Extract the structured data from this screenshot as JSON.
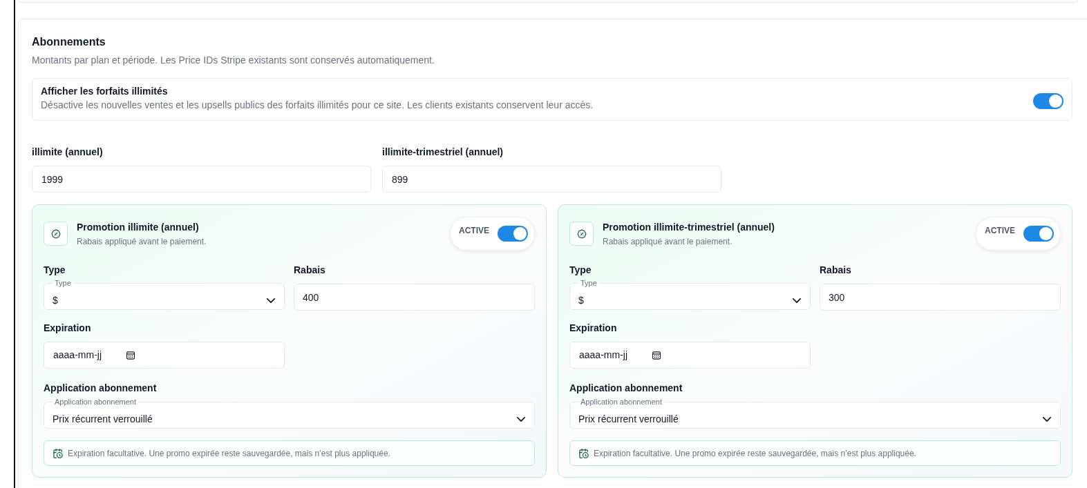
{
  "section": {
    "title": "Abonnements",
    "description": "Montants par plan et période. Les Price IDs Stripe existants sont conservés automatiquement."
  },
  "unlimited_setting": {
    "title": "Afficher les forfaits illimités",
    "description": "Désactive les nouvelles ventes et les upsells publics des forfaits illimités pour ce site. Les clients existants conservent leur accès.",
    "on": true
  },
  "price_fields": [
    {
      "label": "illimite (annuel)",
      "value": "1999"
    },
    {
      "label": "illimite-trimestriel (annuel)",
      "value": "899"
    }
  ],
  "promotions": [
    {
      "title": "Promotion illimite (annuel)",
      "subtitle": "Rabais appliqué avant le paiement.",
      "status_label": "ACTIVE",
      "active": true,
      "type": {
        "label": "Type",
        "floating_label": "Type",
        "value": "$"
      },
      "discount": {
        "label": "Rabais",
        "value": "400"
      },
      "expiration": {
        "label": "Expiration",
        "placeholder": "aaaa-mm-jj"
      },
      "application": {
        "label": "Application abonnement",
        "floating_label": "Application abonnement",
        "value": "Prix récurrent verrouillé"
      },
      "note": "Expiration facultative. Une promo expirée reste sauvegardée, mais n’est plus appliquée."
    },
    {
      "title": "Promotion illimite-trimestriel (annuel)",
      "subtitle": "Rabais appliqué avant le paiement.",
      "status_label": "ACTIVE",
      "active": true,
      "type": {
        "label": "Type",
        "floating_label": "Type",
        "value": "$"
      },
      "discount": {
        "label": "Rabais",
        "value": "300"
      },
      "expiration": {
        "label": "Expiration",
        "placeholder": "aaaa-mm-jj"
      },
      "application": {
        "label": "Application abonnement",
        "floating_label": "Application abonnement",
        "value": "Prix récurrent verrouillé"
      },
      "note": "Expiration facultative. Une promo expirée reste sauvegardée, mais n’est plus appliquée."
    }
  ]
}
